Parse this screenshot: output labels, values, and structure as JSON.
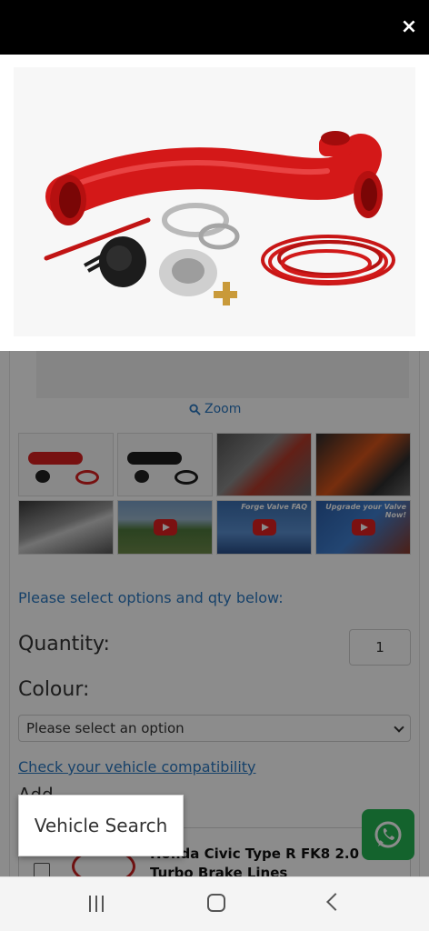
{
  "lightbox": {
    "close_symbol": "×",
    "image_alt": "Red silicone intake hose kit with valve, clamps and vacuum tubing"
  },
  "gallery": {
    "zoom_label": "Zoom",
    "thumbnails": [
      {
        "kind": "photo",
        "caption": ""
      },
      {
        "kind": "photo",
        "caption": ""
      },
      {
        "kind": "photo",
        "caption": ""
      },
      {
        "kind": "photo",
        "caption": ""
      },
      {
        "kind": "photo",
        "caption": ""
      },
      {
        "kind": "video",
        "caption": ""
      },
      {
        "kind": "video",
        "caption": "Forge Valve FAQ"
      },
      {
        "kind": "video",
        "caption": "Upgrade your Valve Now!"
      }
    ]
  },
  "options": {
    "prompt": "Please select options and qty below:",
    "quantity_label": "Quantity:",
    "quantity_value": "1",
    "colour_label": "Colour:",
    "colour_selected": "Please select an option",
    "compat_link": "Check your vehicle compatibility",
    "addon_label": "Add",
    "addon_item_title": "Honda Civic Type R FK8 2.0 Turbo Brake Lines"
  },
  "floating": {
    "vehicle_search_label": "Vehicle Search"
  },
  "colors": {
    "link": "#2b78c2",
    "whatsapp": "#25b553",
    "hose_red": "#d91f1f"
  }
}
